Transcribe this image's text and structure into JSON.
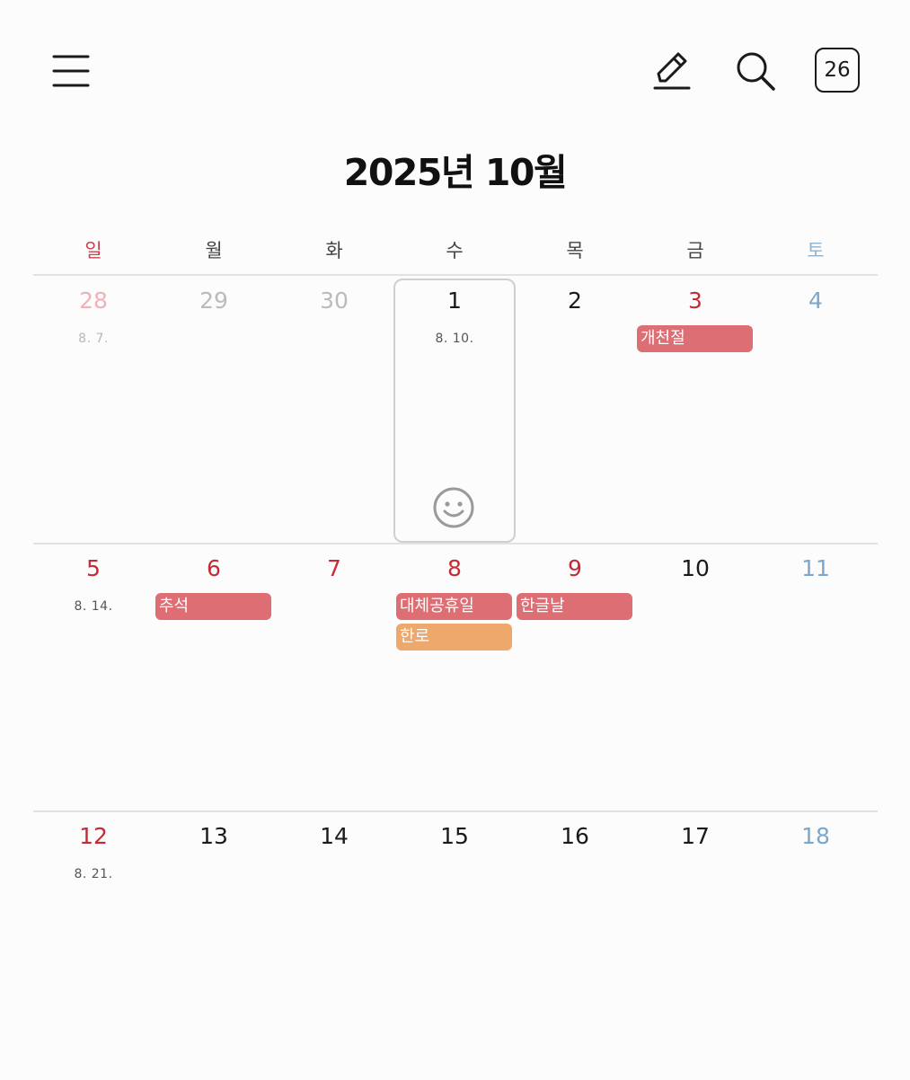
{
  "header": {
    "menu_icon": "hamburger-menu-icon",
    "edit_icon": "pen-icon",
    "search_icon": "search-icon",
    "today_label": "26",
    "title": "2025년 10월"
  },
  "colors": {
    "sunday": "#c9434f",
    "saturday": "#8fb3cf",
    "holiday_event": "#dc6e74",
    "other_event": "#eea86c",
    "selected_border": "#cfcfcf"
  },
  "weekdays": [
    "일",
    "월",
    "화",
    "수",
    "목",
    "금",
    "토"
  ],
  "weeks": [
    {
      "days": [
        {
          "num": "28",
          "lunar": "8. 7.",
          "outside": true
        },
        {
          "num": "29",
          "outside": true
        },
        {
          "num": "30",
          "outside": true
        },
        {
          "num": "1",
          "lunar": "8. 10.",
          "selected": true,
          "mood_icon": "smiley-face-icon"
        },
        {
          "num": "2"
        },
        {
          "num": "3",
          "holiday": true,
          "events": [
            "개천절"
          ]
        },
        {
          "num": "4"
        }
      ]
    },
    {
      "days": [
        {
          "num": "5",
          "lunar": "8. 14."
        },
        {
          "num": "6",
          "holiday": true,
          "events": [
            "추석"
          ]
        },
        {
          "num": "7",
          "holiday": true
        },
        {
          "num": "8",
          "holiday": true,
          "events": [
            "대체공휴일",
            "한로"
          ]
        },
        {
          "num": "9",
          "holiday": true,
          "events": [
            "한글날"
          ]
        },
        {
          "num": "10"
        },
        {
          "num": "11"
        }
      ]
    },
    {
      "days": [
        {
          "num": "12",
          "lunar": "8. 21."
        },
        {
          "num": "13"
        },
        {
          "num": "14"
        },
        {
          "num": "15"
        },
        {
          "num": "16"
        },
        {
          "num": "17"
        },
        {
          "num": "18"
        }
      ]
    }
  ]
}
